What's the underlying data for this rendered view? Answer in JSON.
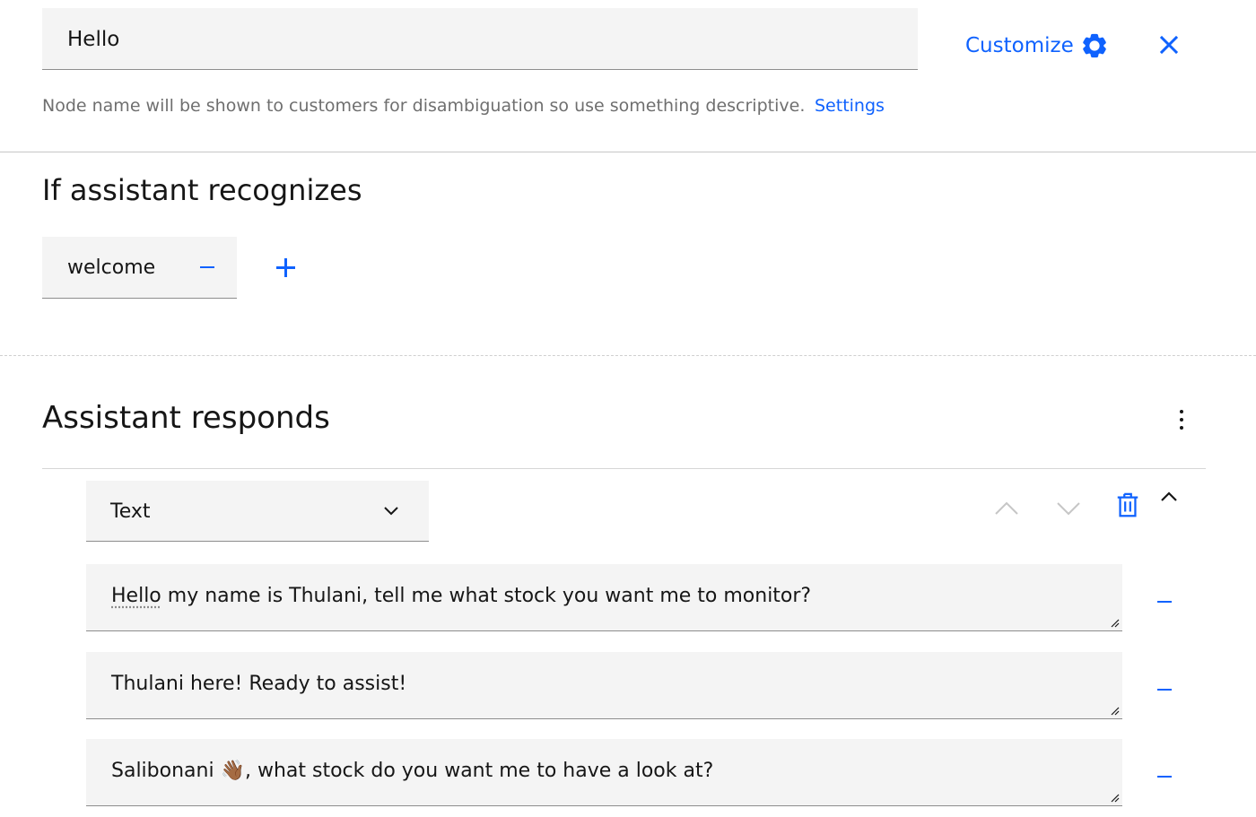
{
  "node": {
    "name_value": "Hello",
    "customize_label": "Customize",
    "helper_text": "Node name will be shown to customers for disambiguation so use something descriptive.",
    "settings_label": "Settings"
  },
  "conditions": {
    "title": "If assistant recognizes",
    "intents": [
      {
        "label": "welcome"
      }
    ]
  },
  "responses": {
    "title": "Assistant responds",
    "type_label": "Text",
    "variations": [
      {
        "first_word": "Hello",
        "rest": " my name is Thulani, tell me what stock you want me to monitor?"
      },
      {
        "text": "Thulani here! Ready to assist!"
      },
      {
        "text": "Salibonani 👋🏾, what stock do you want me to have a look at?"
      }
    ]
  },
  "colors": {
    "accent": "#0f62fe",
    "field_bg": "#f4f4f4",
    "text": "#161616",
    "helper": "#6f6f6f",
    "disabled": "#c6c6c6"
  },
  "icons": {
    "customize": "gear-icon",
    "close": "close-icon",
    "add": "plus-icon",
    "remove": "minus-icon",
    "overflow": "overflow-menu-vertical-icon",
    "select": "chevron-down-icon",
    "move_up": "chevron-up-icon",
    "move_down": "chevron-down-icon",
    "delete": "trash-icon",
    "collapse": "chevron-up-icon"
  }
}
